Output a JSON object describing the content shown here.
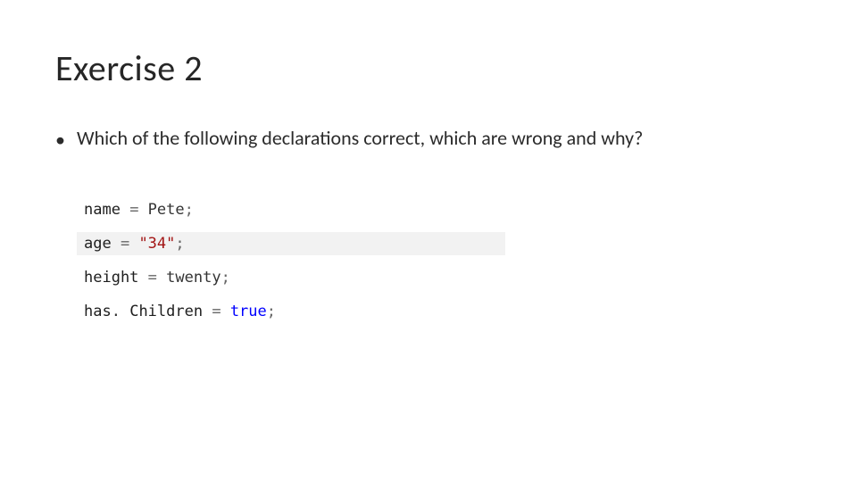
{
  "title": "Exercise 2",
  "bullet": {
    "marker": "•",
    "text": "Which of the following declarations correct, which are wrong and why?"
  },
  "code": {
    "lines": [
      {
        "highlight": false,
        "tokens": [
          {
            "cls": "tok-ident",
            "t": "name"
          },
          {
            "cls": "tok-op",
            "t": " = "
          },
          {
            "cls": "tok-text",
            "t": "Pete"
          },
          {
            "cls": "tok-op",
            "t": ";"
          }
        ]
      },
      {
        "highlight": true,
        "tokens": [
          {
            "cls": "tok-ident",
            "t": "age"
          },
          {
            "cls": "tok-op",
            "t": " = "
          },
          {
            "cls": "tok-str",
            "t": "\"34\""
          },
          {
            "cls": "tok-op",
            "t": ";"
          }
        ]
      },
      {
        "highlight": false,
        "tokens": [
          {
            "cls": "tok-ident",
            "t": "height"
          },
          {
            "cls": "tok-op",
            "t": " = "
          },
          {
            "cls": "tok-text",
            "t": "twenty"
          },
          {
            "cls": "tok-op",
            "t": ";"
          }
        ]
      },
      {
        "highlight": false,
        "tokens": [
          {
            "cls": "tok-ident",
            "t": "has"
          },
          {
            "cls": "tok-dot",
            "t": ". "
          },
          {
            "cls": "tok-ident",
            "t": "Children"
          },
          {
            "cls": "tok-op",
            "t": " = "
          },
          {
            "cls": "tok-kw",
            "t": "true"
          },
          {
            "cls": "tok-op",
            "t": ";"
          }
        ]
      }
    ]
  }
}
